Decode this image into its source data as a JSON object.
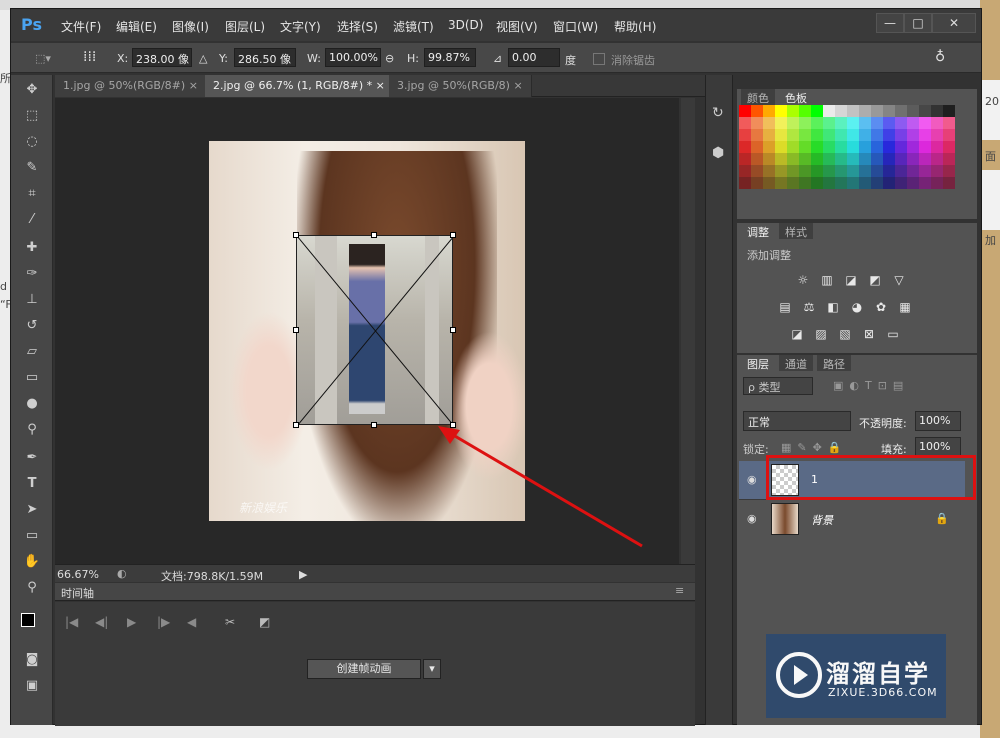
{
  "app": {
    "logo": "Ps"
  },
  "menu": [
    "文件(F)",
    "编辑(E)",
    "图像(I)",
    "图层(L)",
    "文字(Y)",
    "选择(S)",
    "滤镜(T)",
    "3D(D)",
    "视图(V)",
    "窗口(W)",
    "帮助(H)"
  ],
  "window_controls": {
    "minimize": "—",
    "maximize": "□",
    "close": "✕"
  },
  "options": {
    "x_label": "X:",
    "x_value": "238.00 像",
    "y_label": "Y:",
    "y_value": "286.50 像",
    "w_label": "W:",
    "w_value": "100.00%",
    "h_label": "H:",
    "h_value": "99.87%",
    "angle_value": "0.00",
    "angle_unit": "度",
    "antialias_label": "消除锯齿"
  },
  "doc_tabs": [
    {
      "label": "1.jpg @ 50%(RGB/8#)",
      "close": "×"
    },
    {
      "label": "2.jpg @ 66.7% (1, RGB/8#) *",
      "close": "×"
    },
    {
      "label": "3.jpg @ 50%(RGB/8)",
      "close": "×"
    }
  ],
  "status": {
    "zoom": "66.67%",
    "doc": "文档:798.8K/1.59M",
    "arrow": "▶"
  },
  "canvas": {
    "watermark": "新浪娱乐"
  },
  "timeline": {
    "tab": "时间轴",
    "create_button": "创建帧动画",
    "dropdown": "▾"
  },
  "panels": {
    "color_tab": "颜色",
    "swatches_tab": "色板",
    "adjust_tab": "调整",
    "styles_tab": "样式",
    "add_adjust": "添加调整",
    "layers_tab": "图层",
    "channels_tab": "通道",
    "paths_tab": "路径",
    "kind_filter": "ρ 类型",
    "blend_mode": "正常",
    "opacity_label": "不透明度:",
    "opacity_value": "100%",
    "lock_label": "锁定:",
    "fill_label": "填充:",
    "fill_value": "100%"
  },
  "layers": [
    {
      "name": "1",
      "selected": true
    },
    {
      "name": "背景",
      "locked": true
    }
  ],
  "watermark_logo": {
    "big": "溜溜自学",
    "small": "ZIXUE.3D66.COM"
  },
  "bg_fragments": {
    "left1": "所",
    "left2": "d",
    "left3": "“F",
    "right1": "20",
    "right2": "面",
    "right3": "加"
  },
  "colors": {
    "annotation_red": "#dd1111",
    "logo_blue": "#2f4a6e"
  }
}
